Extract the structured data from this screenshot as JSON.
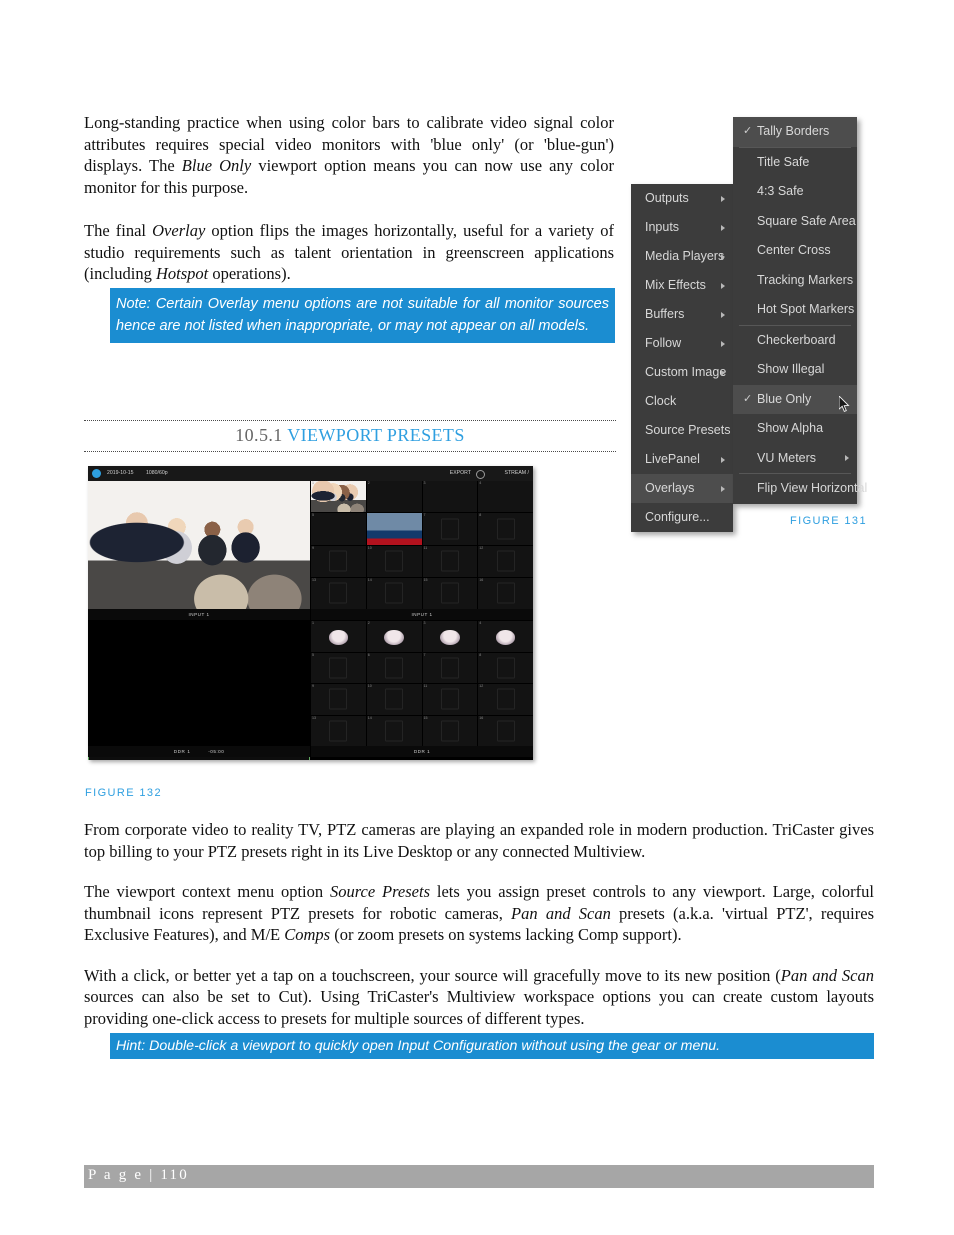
{
  "document": {
    "paragraphs": {
      "p1_parts": [
        "Long-standing practice when using color bars to calibrate video signal color attributes requires special video monitors with 'blue only' (or 'blue-gun') displays.  The ",
        "Blue Only",
        " viewport option means you can now use any color monitor for this purpose."
      ],
      "p2_parts": [
        "The final ",
        "Overlay",
        " option flips the images horizontally, useful for a variety of studio requirements such as talent orientation in greenscreen applications (including ",
        "Hotspot",
        " operations)."
      ],
      "note": "Note: Certain Overlay menu options are not suitable for all monitor sources hence are not listed when inappropriate, or may  not appear on all models.",
      "p3": "From corporate video to reality TV, PTZ cameras are playing an expanded role in modern production. TriCaster gives top billing to your PTZ presets right in its Live Desktop or any connected Multiview.",
      "p4_parts": [
        "The viewport context menu option ",
        "Source Presets",
        " lets you assign preset controls to any viewport. Large, colorful thumbnail icons represent PTZ presets for robotic cameras, ",
        "Pan and Scan",
        " presets (a.k.a. 'virtual PTZ', requires Exclusive Features), and M/E ",
        "Comps",
        " (or zoom presets on systems lacking Comp support)."
      ],
      "p5_parts": [
        "With a click, or better yet a tap on a touchscreen, your source will gracefully move to its new position (",
        "Pan and Scan",
        " sources can also be set to Cut). Using TriCaster's Multiview workspace options you can create custom layouts providing one-click access to presets for multiple sources of different types."
      ],
      "hint": "Hint: Double-click a viewport to quickly open Input Configuration without using the gear or menu."
    },
    "section_heading": {
      "number": "10.5.1",
      "title": "VIEWPORT PRESETS"
    },
    "figure_captions": {
      "fig131": "FIGURE 131",
      "fig132": "FIGURE 132"
    },
    "footer": {
      "page_label": "P a g e  | 110"
    },
    "colors": {
      "accent_blue": "#2f9fe0",
      "callout_blue": "#1b8dd1",
      "menu_bg": "#3c3c3c",
      "menu_highlight": "#4d4d4d",
      "footer_gray": "#a6a6a6"
    }
  },
  "context_menu": {
    "main_items": [
      {
        "label": "Outputs",
        "submenu": true,
        "checked": false,
        "highlighted": false
      },
      {
        "label": "Inputs",
        "submenu": true,
        "checked": false,
        "highlighted": false
      },
      {
        "label": "Media Players",
        "submenu": true,
        "checked": false,
        "highlighted": false
      },
      {
        "label": "Mix Effects",
        "submenu": true,
        "checked": false,
        "highlighted": false
      },
      {
        "label": "Buffers",
        "submenu": true,
        "checked": false,
        "highlighted": false
      },
      {
        "label": "Follow",
        "submenu": true,
        "checked": false,
        "highlighted": false
      },
      {
        "label": "Custom Image",
        "submenu": true,
        "checked": false,
        "highlighted": false
      },
      {
        "label": "Clock",
        "submenu": false,
        "checked": false,
        "highlighted": false
      },
      {
        "label": "Source Presets",
        "submenu": false,
        "checked": false,
        "highlighted": false
      },
      {
        "label": "LivePanel",
        "submenu": true,
        "checked": false,
        "highlighted": false
      },
      {
        "label": "Overlays",
        "submenu": true,
        "checked": false,
        "highlighted": true
      },
      {
        "label": "Configure...",
        "submenu": false,
        "checked": false,
        "highlighted": false
      }
    ],
    "overlays_submenu_items": [
      {
        "label": "Tally Borders",
        "submenu": false,
        "checked": true,
        "highlighted": true,
        "separator_after": true
      },
      {
        "label": "Title Safe",
        "submenu": false,
        "checked": false,
        "highlighted": false,
        "separator_after": false
      },
      {
        "label": "4:3 Safe",
        "submenu": false,
        "checked": false,
        "highlighted": false,
        "separator_after": false
      },
      {
        "label": "Square Safe Area",
        "submenu": false,
        "checked": false,
        "highlighted": false,
        "separator_after": false
      },
      {
        "label": "Center Cross",
        "submenu": false,
        "checked": false,
        "highlighted": false,
        "separator_after": false
      },
      {
        "label": "Tracking Markers",
        "submenu": false,
        "checked": false,
        "highlighted": false,
        "separator_after": false
      },
      {
        "label": "Hot Spot Markers",
        "submenu": false,
        "checked": false,
        "highlighted": false,
        "separator_after": true
      },
      {
        "label": "Checkerboard",
        "submenu": false,
        "checked": false,
        "highlighted": false,
        "separator_after": false
      },
      {
        "label": "Show Illegal",
        "submenu": false,
        "checked": false,
        "highlighted": false,
        "separator_after": false
      },
      {
        "label": "Blue Only",
        "submenu": false,
        "checked": true,
        "highlighted": true,
        "separator_after": false
      },
      {
        "label": "Show Alpha",
        "submenu": false,
        "checked": false,
        "highlighted": false,
        "separator_after": false
      },
      {
        "label": "VU Meters",
        "submenu": true,
        "checked": false,
        "highlighted": false,
        "separator_after": true
      },
      {
        "label": "Flip View Horizontal",
        "submenu": false,
        "checked": false,
        "highlighted": false,
        "separator_after": false
      }
    ],
    "check_glyph": "✓",
    "cursor": "mouse-pointer"
  },
  "multiview_screenshot": {
    "topbar": {
      "date": "2019-10-15",
      "format": "1080/60p",
      "export_label": "EXPORT",
      "stream_label": "STREAM /"
    },
    "quadrants": [
      {
        "name": "top-left-viewport",
        "label": "INPUT 1"
      },
      {
        "name": "top-right-grid",
        "label": "INPUT 1"
      },
      {
        "name": "bottom-left-viewport",
        "label": "DDR 1"
      },
      {
        "name": "bottom-right-grid",
        "label": "DDR 1"
      }
    ],
    "ddr_transport": {
      "name": "DDR 1",
      "timecode": "-05:00"
    },
    "preset_cell_numbers": [
      "1",
      "2",
      "3",
      "4",
      "5",
      "6",
      "7",
      "8",
      "9",
      "10",
      "11",
      "12",
      "13",
      "14",
      "15",
      "16"
    ]
  }
}
